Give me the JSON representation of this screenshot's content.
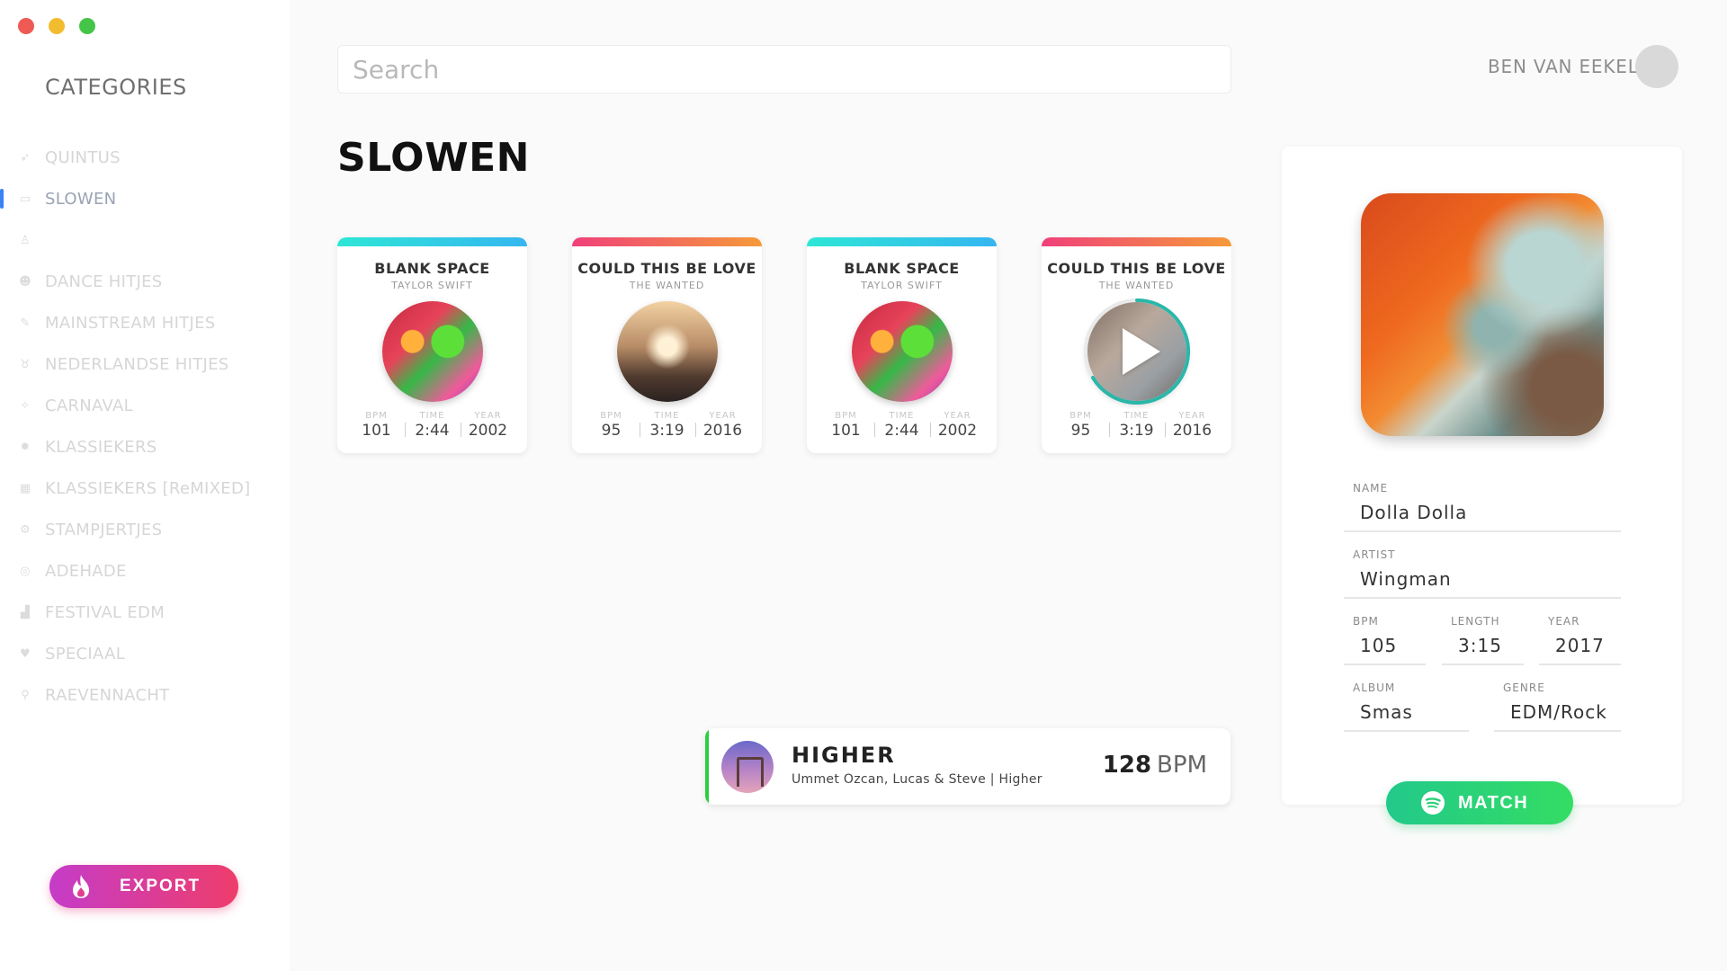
{
  "search": {
    "placeholder": "Search"
  },
  "user": {
    "name": "BEN VAN EEKELEN"
  },
  "sidebar": {
    "title": "CATEGORIES",
    "items": [
      {
        "label": "QUINTUS",
        "icon": "rocket-icon"
      },
      {
        "label": "SLOWEN",
        "icon": "sofa-icon",
        "active": true
      },
      {
        "label": "",
        "icon": "person-icon"
      },
      {
        "label": "DANCE HITJES",
        "icon": "disco-icon"
      },
      {
        "label": "MAINSTREAM HITJES",
        "icon": "pencil-icon"
      },
      {
        "label": "NEDERLANDSE HITJES",
        "icon": "lion-icon"
      },
      {
        "label": "CARNAVAL",
        "icon": "horn-icon"
      },
      {
        "label": "KLASSIEKERS",
        "icon": "star-icon"
      },
      {
        "label": "KLASSIEKERS [ReMIXED]",
        "icon": "grid-icon"
      },
      {
        "label": "STAMPJERTJES",
        "icon": "gear-icon"
      },
      {
        "label": "ADEHADE",
        "icon": "record-icon"
      },
      {
        "label": "FESTIVAL EDM",
        "icon": "chart-icon"
      },
      {
        "label": "SPECIAAL",
        "icon": "heart-icon"
      },
      {
        "label": "RAEVENNACHT",
        "icon": "pin-icon"
      }
    ],
    "export_label": "EXPORT"
  },
  "page": {
    "title": "SLOWEN"
  },
  "stat_labels": {
    "bpm": "BPM",
    "time": "TIME",
    "year": "YEAR"
  },
  "cards": [
    {
      "title": "BLANK SPACE",
      "artist": "TAYLOR SWIFT",
      "bpm": "101",
      "time": "2:44",
      "year": "2002"
    },
    {
      "title": "COULD THIS BE LOVE",
      "artist": "THE WANTED",
      "bpm": "95",
      "time": "3:19",
      "year": "2016"
    },
    {
      "title": "BLANK SPACE",
      "artist": "TAYLOR SWIFT",
      "bpm": "101",
      "time": "2:44",
      "year": "2002"
    },
    {
      "title": "COULD THIS BE LOVE",
      "artist": "THE WANTED",
      "bpm": "95",
      "time": "3:19",
      "year": "2016",
      "playing": true
    }
  ],
  "now_playing": {
    "title": "HIGHER",
    "subtitle": "Ummet Ozcan, Lucas & Steve | Higher",
    "bpm": "128",
    "bpm_unit": "BPM"
  },
  "detail": {
    "name_label": "NAME",
    "name": "Dolla Dolla",
    "artist_label": "ARTIST",
    "artist": "Wingman",
    "bpm_label": "BPM",
    "bpm": "105",
    "length_label": "LENGTH",
    "length": "3:15",
    "year_label": "YEAR",
    "year": "2017",
    "album_label": "ALBUM",
    "album": "Smas",
    "genre_label": "GENRE",
    "genre": "EDM/Rock",
    "match_label": "MATCH"
  },
  "colors": {
    "accent_blue": "#3b82f6",
    "export_gradient_start": "#c53cc9",
    "export_gradient_end": "#ee3d6b",
    "match_green": "#2ecc71",
    "now_playing_accent": "#2ecc40"
  }
}
